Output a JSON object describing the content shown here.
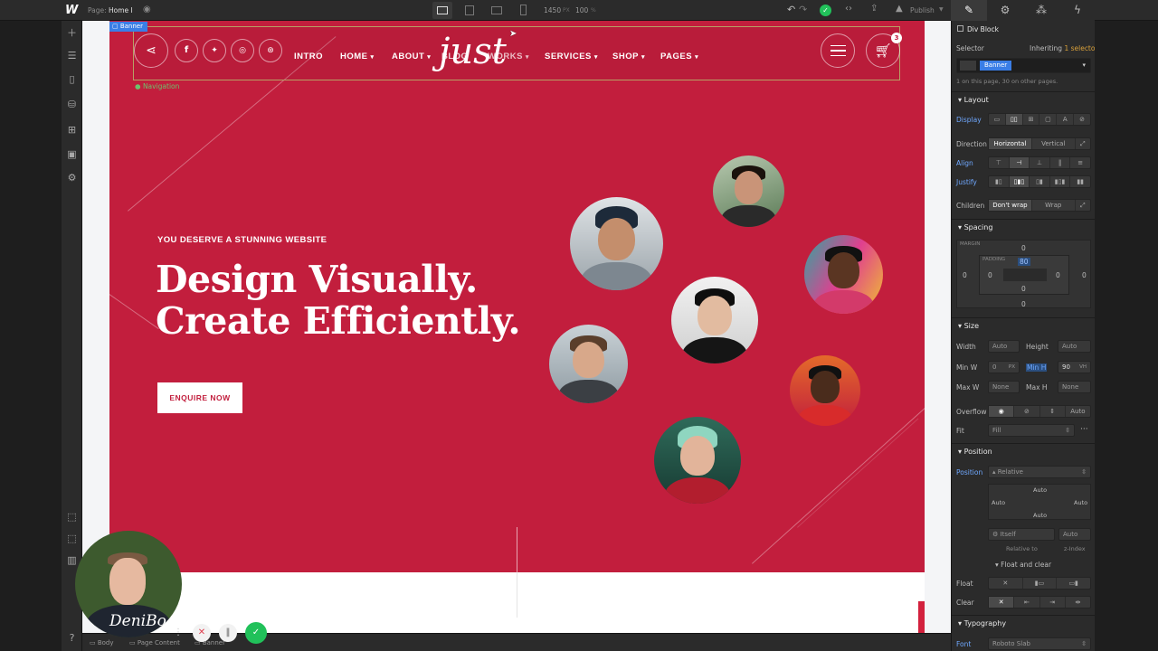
{
  "topbar": {
    "logo": "W",
    "page_label": "Page:",
    "page_name": "Home I",
    "canvas_width": "1450",
    "px_unit": "PX",
    "zoom": "100",
    "pct_unit": "%",
    "publish_label": "Publish"
  },
  "nav": {
    "links": [
      {
        "label": "INTRO",
        "dropdown": false
      },
      {
        "label": "HOME",
        "dropdown": true
      },
      {
        "label": "ABOUT",
        "dropdown": true
      },
      {
        "label": "BLOG",
        "dropdown": false
      },
      {
        "label": "WORKS",
        "dropdown": true
      },
      {
        "label": "SERVICES",
        "dropdown": true
      },
      {
        "label": "SHOP",
        "dropdown": true
      },
      {
        "label": "PAGES",
        "dropdown": true
      }
    ],
    "logo_text": "just",
    "cart_count": "3",
    "selection_label": "Navigation"
  },
  "banner_badge": "Banner",
  "hero": {
    "eyebrow": "YOU DESERVE A STUNNING WEBSITE",
    "headline_1": "Design Visually.",
    "headline_2": "Create Efficiently.",
    "cta": "ENQUIRE NOW"
  },
  "colors": {
    "hero_bg": "#c21e3d",
    "accent_blue": "#3a7ee6",
    "scroll_top": "#d3213d",
    "success": "#21c15a"
  },
  "panel": {
    "tabs": [
      "style-brush-icon",
      "gear-icon",
      "drops-icon",
      "bolt-icon"
    ],
    "element_type": "Div Block",
    "selector_label": "Selector",
    "inheriting": "Inheriting",
    "inheriting_count": "1 selector",
    "selector_value": "Banner",
    "usage_note": "1 on this page, 30 on other pages.",
    "layout": {
      "title": "Layout",
      "display": "Display",
      "direction": "Direction",
      "horizontal": "Horizontal",
      "vertical": "Vertical",
      "align": "Align",
      "justify": "Justify",
      "children": "Children",
      "dont_wrap": "Don't wrap",
      "wrap": "Wrap"
    },
    "spacing": {
      "title": "Spacing",
      "margin": "MARGIN",
      "padding": "PADDING",
      "margin_top": "0",
      "margin_left": "0",
      "margin_right": "0",
      "margin_bottom": "0",
      "pad_top": "80",
      "pad_left": "0",
      "pad_right": "0",
      "pad_bottom": "0"
    },
    "size": {
      "title": "Size",
      "width": "Width",
      "width_val": "Auto",
      "height": "Height",
      "height_val": "Auto",
      "min_w": "Min W",
      "min_w_val": "0",
      "min_w_unit": "PX",
      "min_h": "Min H",
      "min_h_val": "90",
      "min_h_unit": "VH",
      "max_w": "Max W",
      "max_w_val": "None",
      "max_h": "Max H",
      "max_h_val": "None",
      "overflow": "Overflow",
      "overflow_auto": "Auto",
      "fit": "Fit",
      "fit_val": "Fill"
    },
    "position": {
      "title": "Position",
      "position": "Position",
      "position_val": "Relative",
      "top": "Auto",
      "left": "Auto",
      "right": "Auto",
      "bottom": "Auto",
      "relative_itself": "Itself",
      "relative_to": "Relative to",
      "zindex_val": "Auto",
      "zindex": "z-Index",
      "float_clear": "Float and clear",
      "float": "Float",
      "clear": "Clear"
    },
    "typography": {
      "title": "Typography",
      "font": "Font",
      "font_val": "Roboto Slab"
    }
  },
  "bottombar": {
    "crumbs": [
      "Body",
      "Page Content",
      "Banner"
    ]
  },
  "webcam": {
    "watermark": "DeniBo"
  }
}
